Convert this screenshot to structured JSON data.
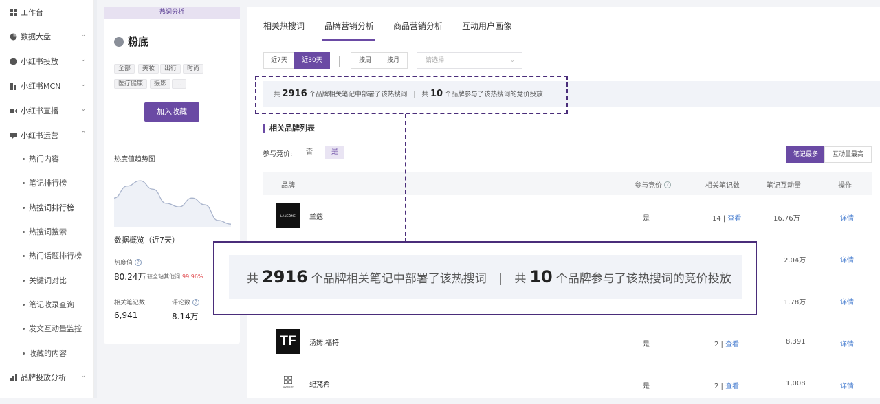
{
  "sidebar": {
    "items": [
      {
        "label": "工作台",
        "icon": "grid-icon"
      },
      {
        "label": "数据大盘",
        "icon": "pie-icon"
      },
      {
        "label": "小红书投放",
        "icon": "cube-icon"
      },
      {
        "label": "小红书MCN",
        "icon": "building-icon"
      },
      {
        "label": "小红书直播",
        "icon": "video-icon"
      },
      {
        "label": "小红书运营",
        "icon": "chat-icon"
      }
    ],
    "sub_items": [
      "热门内容",
      "笔记排行榜",
      "热搜词排行榜",
      "热搜词搜索",
      "热门话题排行榜",
      "关键词对比",
      "笔记收录查询",
      "发文互动量监控",
      "收藏的内容"
    ],
    "bottom_item": {
      "label": "品牌投放分析",
      "icon": "bar-chart-icon"
    }
  },
  "keyword_panel": {
    "tag": "热词分析",
    "keyword": "粉底",
    "chips": [
      "全部",
      "美妆",
      "出行",
      "时尚",
      "医疗健康",
      "摄影",
      "..."
    ],
    "fav_button": "加入收藏",
    "trend_title": "热度值趋势图",
    "trend_values": [
      0.55,
      0.78,
      0.88,
      0.72,
      0.45,
      0.38,
      0.55,
      0.42,
      0.12,
      0.05
    ],
    "overview_title": "数据概览（近7天）",
    "heat_label": "热度值",
    "heat_value": "80.24万",
    "heat_compare_label": "较全站其他词",
    "heat_compare_value": "99.96%",
    "notes_label": "相关笔记数",
    "notes_value": "6,941",
    "comments_label": "评论数",
    "comments_value": "8.14万"
  },
  "main": {
    "tabs": [
      "相关热搜词",
      "品牌营销分析",
      "商品营销分析",
      "互动用户画像"
    ],
    "active_tab": 1,
    "range": [
      "近7天",
      "近30天"
    ],
    "period": [
      "按周",
      "按月"
    ],
    "select_placeholder": "请选择",
    "summary": {
      "prefix": "共",
      "brand_count": "2916",
      "mid": "个品牌相关笔记中部署了该热搜词",
      "sep": "|",
      "prefix2": "共",
      "bid_count": "10",
      "suffix": "个品牌参与了该热搜词的竞价投放"
    },
    "section_title": "相关品牌列表",
    "bid_label": "参与竞价:",
    "bid_options": [
      "否",
      "是"
    ],
    "sort_options": [
      "笔记最多",
      "互动量最高"
    ],
    "columns": [
      "品牌",
      "参与竞价",
      "相关笔记数",
      "笔记互动量",
      "操作"
    ],
    "rows": [
      {
        "logo": "LANCÔME",
        "brand": "兰蔻",
        "bid": "是",
        "notes": "14",
        "view": "查看",
        "engagement": "16.76万",
        "action": "详情"
      },
      {
        "logo": "",
        "brand": "",
        "bid": "",
        "notes": "",
        "view": "",
        "engagement": "2.04万",
        "action": "详情"
      },
      {
        "logo": "",
        "brand": "",
        "bid": "",
        "notes": "",
        "view": "",
        "engagement": "1.78万",
        "action": "详情"
      },
      {
        "logo": "TF",
        "brand": "汤姆.福特",
        "bid": "是",
        "notes": "2",
        "view": "查看",
        "engagement": "8,391",
        "action": "详情"
      },
      {
        "logo": "GIVENCHY",
        "brand": "纪梵希",
        "bid": "是",
        "notes": "2",
        "view": "查看",
        "engagement": "1,008",
        "action": "详情"
      }
    ]
  },
  "colors": {
    "accent": "#6a4aa4",
    "link": "#4a7fd0",
    "highlight_red": "#e0474c"
  }
}
